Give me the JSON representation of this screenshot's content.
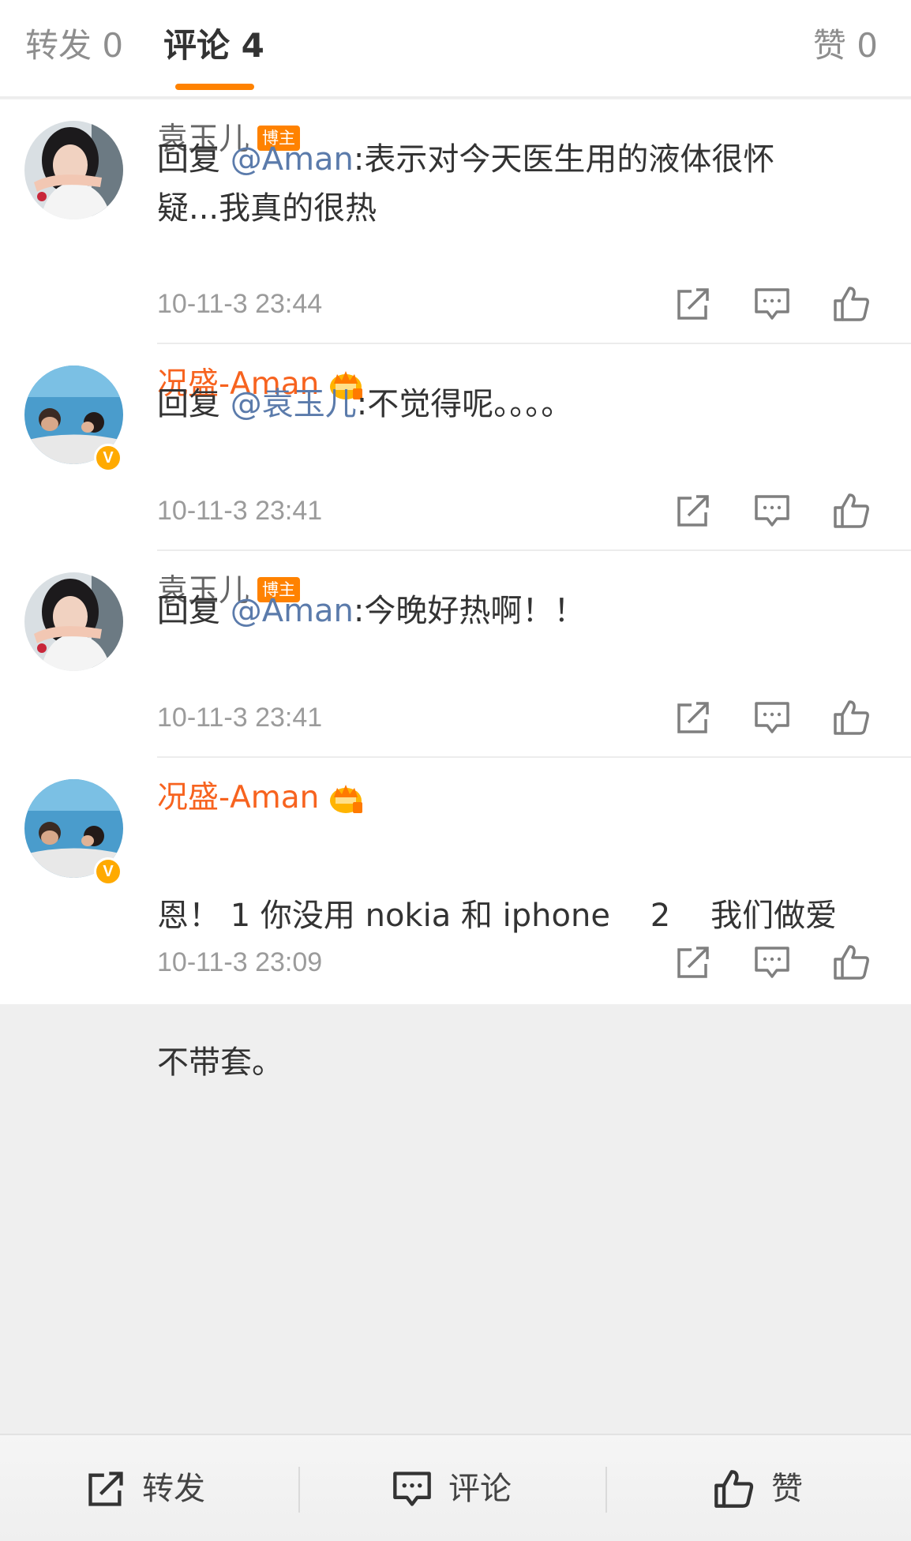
{
  "tabs": {
    "forward": "转发 0",
    "comment": "评论 4",
    "like": "赞 0"
  },
  "comments": [
    {
      "author": "袁玉儿",
      "badge": "博主",
      "reply_prefix": "回复 ",
      "mention": "@Aman",
      "text_line1": ":表示对今天医生用的液体很怀",
      "text_line2": "疑...我真的很热",
      "time": "10-11-3 23:44"
    },
    {
      "author": "况盛-Aman",
      "reply_prefix": "回复 ",
      "mention": "@袁玉儿",
      "text_line1": ":不觉得呢。。。。",
      "time": "10-11-3 23:41"
    },
    {
      "author": "袁玉儿",
      "badge": "博主",
      "reply_prefix": "回复 ",
      "mention": "@Aman",
      "text_line1": ":今晚好热啊！！",
      "time": "10-11-3 23:41"
    },
    {
      "author": "况盛-Aman",
      "text_line1": "恩！ 1 你没用 nokia 和 iphone    2    我们做爱",
      "text_line2": "不带套。",
      "time": "10-11-3 23:09"
    }
  ],
  "toolbar": {
    "forward": "转发",
    "comment": "评论",
    "like": "赞"
  },
  "colors": {
    "accent": "#ff8200",
    "vip_name": "#f7631f",
    "mention": "#5b7bab",
    "background": "#efefef"
  },
  "icons": {
    "verified": "v-verified-icon",
    "vip": "crown-icon",
    "forward": "forward-icon",
    "reply": "comment-icon",
    "like": "thumbs-up-icon"
  },
  "verified_badge_text": "V"
}
